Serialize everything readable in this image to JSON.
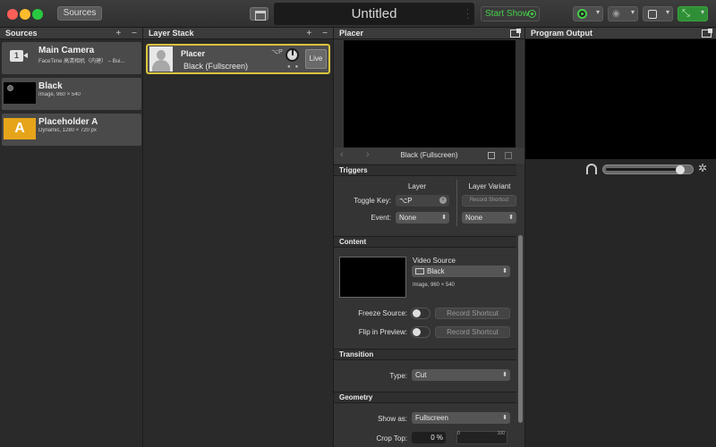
{
  "toolbar": {
    "sources_button": "Sources",
    "document_title": "Untitled",
    "start_show": "Start Show"
  },
  "colors": {
    "accent_green": "#45d04a",
    "selection_yellow": "#d9c43c",
    "placeholder_orange": "#e6a41a"
  },
  "sources": {
    "header": "Sources",
    "add": "+",
    "remove": "−",
    "items": [
      {
        "name": "Main Camera",
        "detail": "FaceTime 高清相机（内建） – Bui...",
        "badge": "1",
        "icon": "camera-icon"
      },
      {
        "name": "Black",
        "detail": "Image, 960 × 540",
        "icon": "black-thumb"
      },
      {
        "name": "Placeholder A",
        "detail": "Dynamic, 1280 × 720 px",
        "badge": "A",
        "icon": "placeholder-icon"
      }
    ]
  },
  "layers": {
    "header": "Layer Stack",
    "add": "+",
    "remove": "−",
    "items": [
      {
        "name": "Placer",
        "variant": "Black (Fullscreen)",
        "shortcut": "⌥P",
        "live": "Live"
      }
    ]
  },
  "placer": {
    "header": "Placer",
    "preview_caption": "Black (Fullscreen)",
    "triggers": {
      "title": "Triggers",
      "layer_col": "Layer",
      "variant_col": "Layer Variant",
      "toggle_key_label": "Toggle Key:",
      "toggle_key_value": "⌥P",
      "record_shortcut_small": "Record Shortcut",
      "event_label": "Event:",
      "event_layer_value": "None",
      "event_variant_value": "None"
    },
    "content": {
      "title": "Content",
      "video_source_label": "Video Source",
      "video_source_value": "Black",
      "video_source_detail": "Image, 960 × 540",
      "freeze_label": "Freeze Source:",
      "freeze_shortcut": "Record Shortcut",
      "flip_label": "Flip in Preview:",
      "flip_shortcut": "Record Shortcut"
    },
    "transition": {
      "title": "Transition",
      "type_label": "Type:",
      "type_value": "Cut"
    },
    "geometry": {
      "title": "Geometry",
      "show_as_label": "Show as:",
      "show_as_value": "Fullscreen",
      "crop_top_label": "Crop Top:",
      "crop_top_value": "0",
      "crop_unit": "%",
      "slider_min": "0",
      "slider_max": "100"
    }
  },
  "output": {
    "header": "Program Output",
    "volume_level": 0.9
  }
}
